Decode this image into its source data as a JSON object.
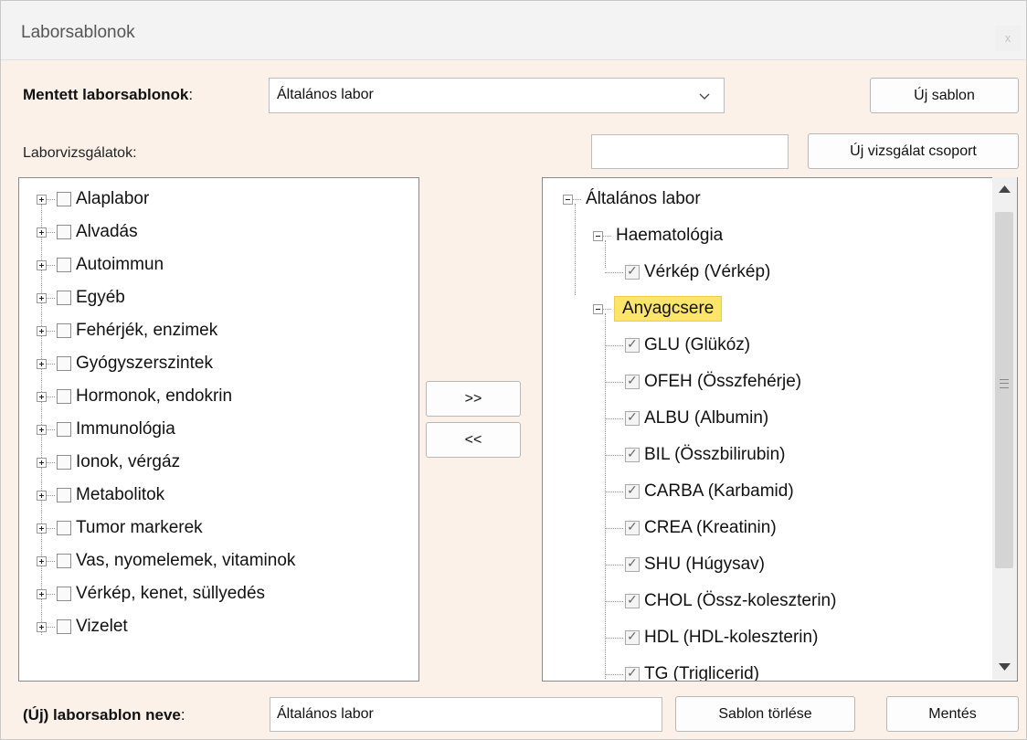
{
  "window": {
    "title": "Laborsablonok",
    "close": "x"
  },
  "saved_templates": {
    "label": "Mentett laborsablonok",
    "colon": ":",
    "selected": "Általános labor"
  },
  "buttons": {
    "new_template": "Új sablon",
    "new_group": "Új vizsgálat csoport",
    "add": ">>",
    "remove": "<<",
    "delete_template": "Sablon törlése",
    "save": "Mentés"
  },
  "lab_tests_label": "Laborvizsgálatok:",
  "group_name_value": "",
  "left_tree": [
    {
      "label": "Alaplabor"
    },
    {
      "label": "Alvadás"
    },
    {
      "label": "Autoimmun"
    },
    {
      "label": "Egyéb"
    },
    {
      "label": "Fehérjék, enzimek"
    },
    {
      "label": "Gyógyszerszintek"
    },
    {
      "label": "Hormonok, endokrin"
    },
    {
      "label": "Immunológia"
    },
    {
      "label": "Ionok, vérgáz"
    },
    {
      "label": "Metabolitok"
    },
    {
      "label": "Tumor markerek"
    },
    {
      "label": "Vas, nyomelemek, vitaminok"
    },
    {
      "label": "Vérkép, kenet, süllyedés"
    },
    {
      "label": "Vizelet"
    }
  ],
  "right_tree": {
    "root": "Általános labor",
    "groups": [
      {
        "label": "Haematológia",
        "items": [
          "Vérkép (Vérkép)"
        ]
      },
      {
        "label": "Anyagcsere",
        "selected": true,
        "items": [
          "GLU (Glükóz)",
          "OFEH (Összfehérje)",
          "ALBU (Albumin)",
          "BIL (Összbilirubin)",
          "CARBA (Karbamid)",
          "CREA (Kreatinin)",
          "SHU (Húgysav)",
          "CHOL (Össz-koleszterin)",
          "HDL (HDL-koleszterin)",
          "TG (Triglicerid)"
        ]
      }
    ]
  },
  "template_name": {
    "label": "(Új) laborsablon neve",
    "colon": ":",
    "value": "Általános labor"
  }
}
